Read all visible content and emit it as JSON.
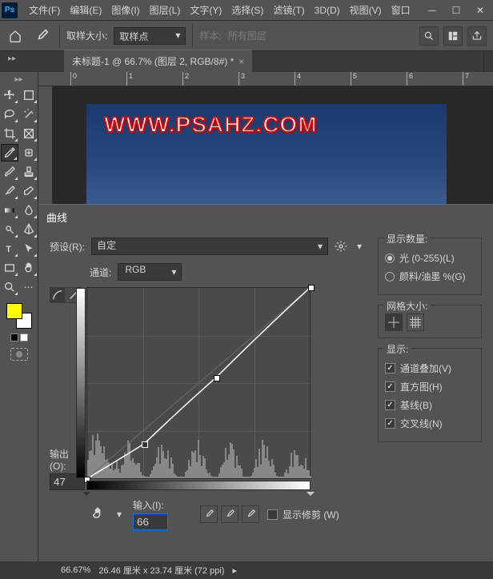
{
  "menu": {
    "items": [
      "文件(F)",
      "编辑(E)",
      "图像(I)",
      "图层(L)",
      "文字(Y)",
      "选择(S)",
      "滤镜(T)",
      "3D(D)",
      "视图(V)",
      "窗口"
    ]
  },
  "options": {
    "sample_size_label": "取样大小:",
    "sample_size_value": "取样点",
    "sample_label": "样本:",
    "sample_value": "所有图层"
  },
  "doc_tab": {
    "title": "未标题-1 @ 66.7% (图层 2, RGB/8#) *"
  },
  "ruler_ticks": [
    "0",
    "1",
    "2",
    "3",
    "4",
    "5",
    "6",
    "7"
  ],
  "watermark": "WWW.PSAHZ.COM",
  "dialog": {
    "title": "曲线",
    "preset_label": "预设(R):",
    "preset_value": "自定",
    "channel_label": "通道:",
    "channel_value": "RGB",
    "output_label": "输出(O):",
    "output_value": "47",
    "input_label": "输入(I):",
    "input_value": "66",
    "show_clipping": "显示修剪 (W)",
    "display_amount": {
      "legend": "显示数量:",
      "light": "光 (0-255)(L)",
      "pigment": "颜料/油墨 %(G)"
    },
    "grid_size": {
      "legend": "网格大小:"
    },
    "show": {
      "legend": "显示:",
      "items": [
        "通道叠加(V)",
        "直方图(H)",
        "基线(B)",
        "交叉线(N)"
      ]
    }
  },
  "status": {
    "zoom": "66.67%",
    "dims": "26.46 厘米 x 23.74 厘米 (72 ppi)"
  },
  "chart_data": {
    "type": "line",
    "title": "曲线",
    "xlabel": "输入",
    "ylabel": "输出",
    "xlim": [
      0,
      255
    ],
    "ylim": [
      0,
      255
    ],
    "series": [
      {
        "name": "RGB",
        "points": [
          [
            0,
            0
          ],
          [
            66,
            47
          ],
          [
            148,
            135
          ],
          [
            255,
            255
          ]
        ]
      }
    ],
    "baseline": [
      [
        0,
        0
      ],
      [
        255,
        255
      ]
    ],
    "selected_point": [
      66,
      47
    ]
  }
}
